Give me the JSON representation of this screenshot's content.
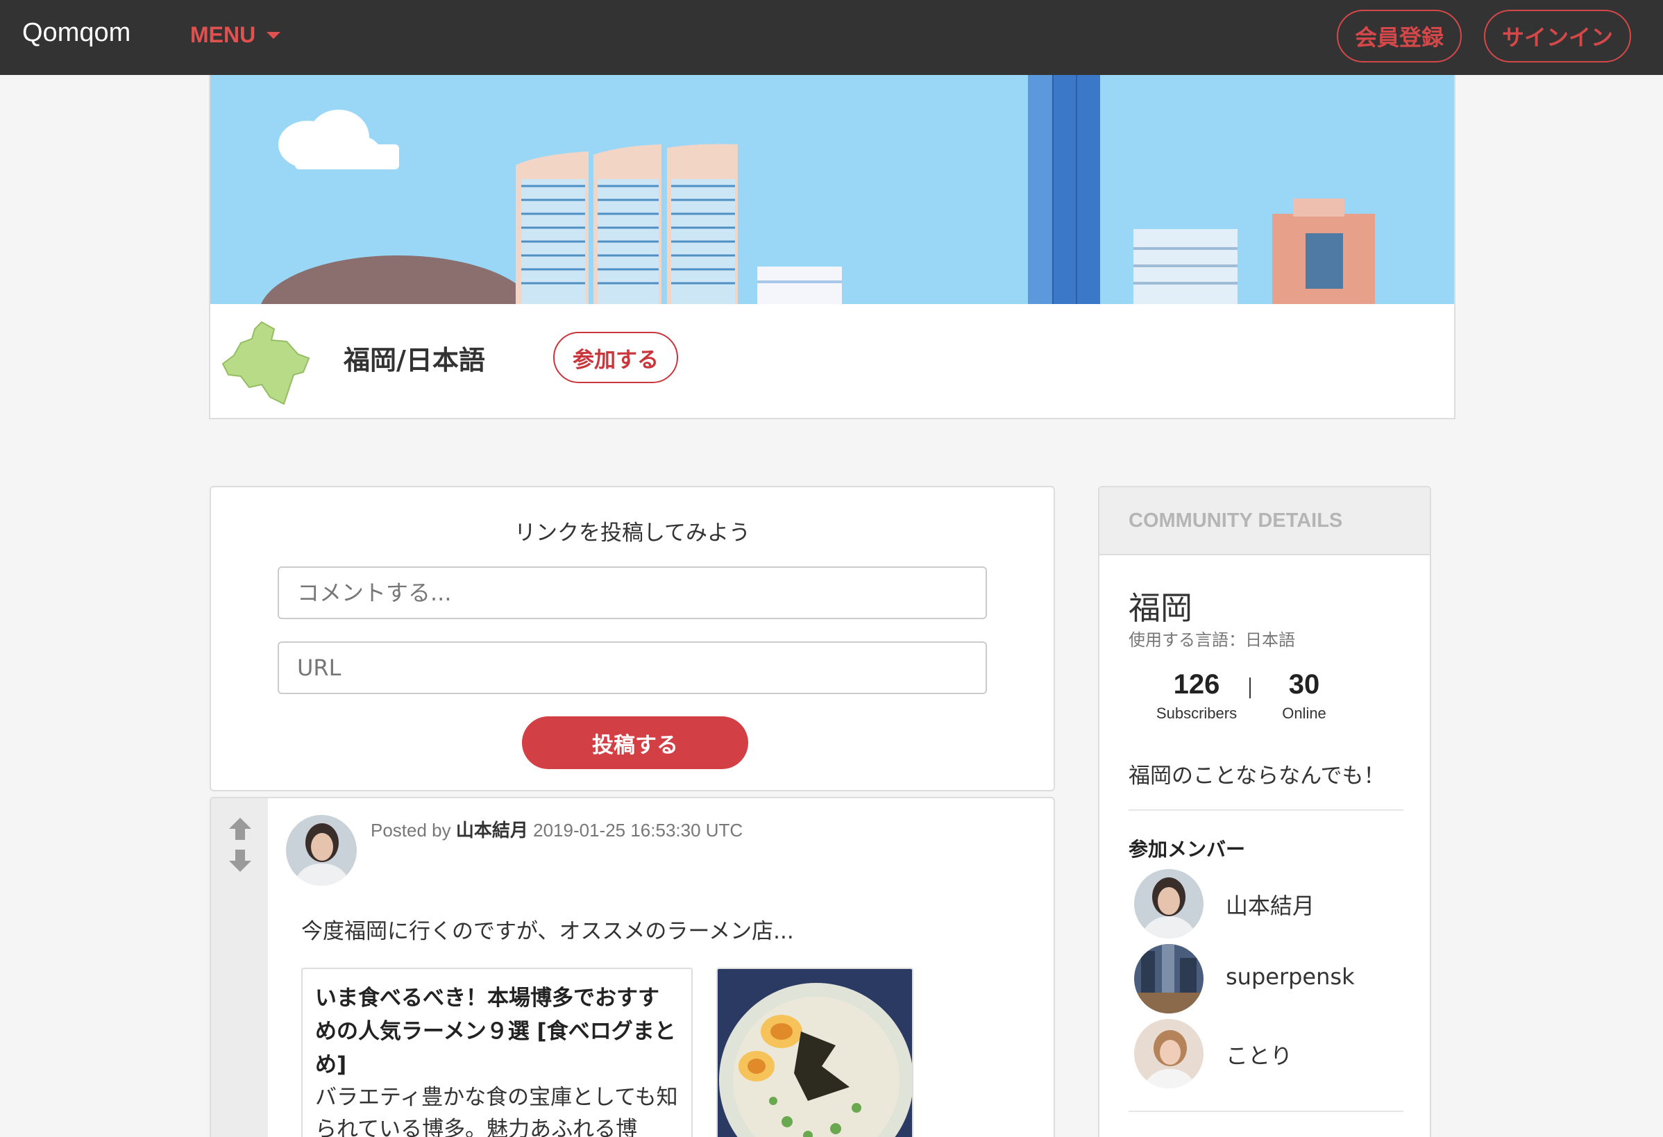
{
  "navbar": {
    "brand": "Qomqom",
    "menu_label": "MENU",
    "register_label": "会員登録",
    "signin_label": "サインイン"
  },
  "community": {
    "name": "福岡/日本語",
    "join_label": "参加する"
  },
  "post_form": {
    "title": "リンクを投稿してみよう",
    "comment_placeholder": "コメントする...",
    "url_placeholder": "URL",
    "submit_label": "投稿する"
  },
  "post": {
    "posted_by_label": "Posted by",
    "author": "山本結月",
    "timestamp": "2019-01-25 16:53:30 UTC",
    "text": "今度福岡に行くのですが、オススメのラーメン店...",
    "link_title": "いま食べるべき！本場博多でおすすめの人気ラーメン９選 [食べログまとめ]",
    "link_desc": "バラエティ豊かな食の宝庫としても知られている博多。魅力あふれる博"
  },
  "sidebar": {
    "header": "COMMUNITY DETAILS",
    "name": "福岡",
    "language": "使用する言語：日本語",
    "subscribers_count": "126",
    "subscribers_label": "Subscribers",
    "online_count": "30",
    "online_label": "Online",
    "description": "福岡のことならなんでも！",
    "members_title": "参加メンバー",
    "members": [
      {
        "name": "山本結月"
      },
      {
        "name": "superpensk"
      },
      {
        "name": "ことり"
      }
    ]
  },
  "colors": {
    "accent": "#d23f44",
    "navbar_bg": "#333333",
    "hero_sky": "#9ad7f6"
  }
}
